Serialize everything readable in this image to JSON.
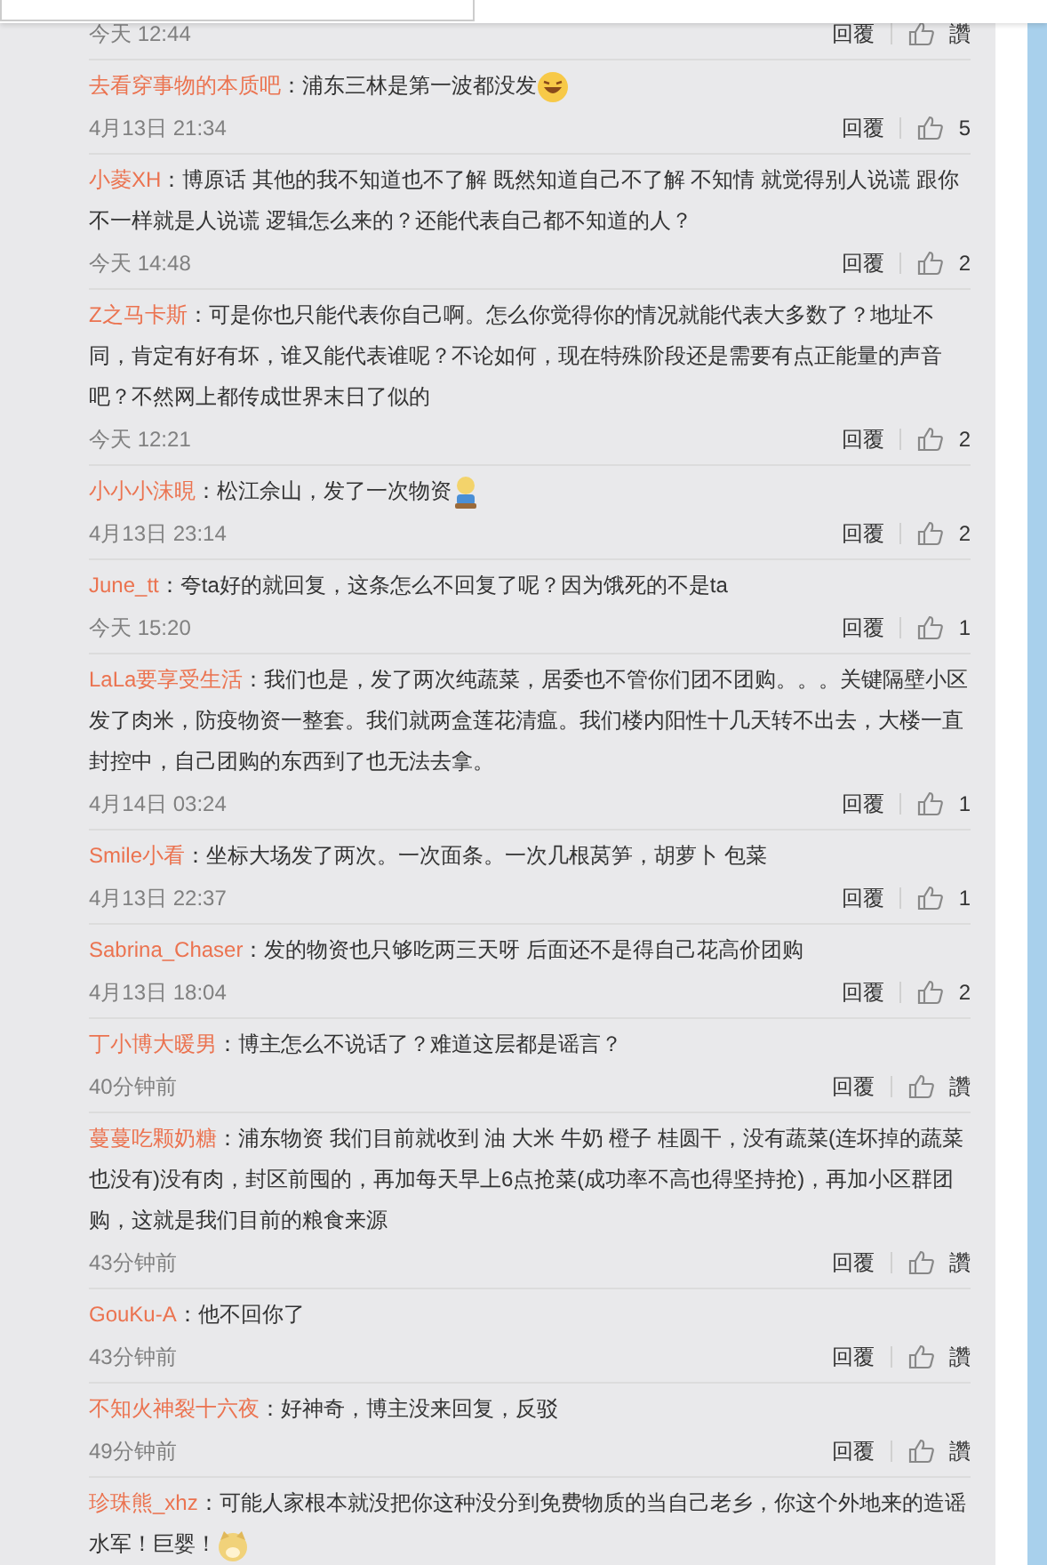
{
  "comments": [
    {
      "time": "今天 12:44",
      "reply": "回覆",
      "like": "讚"
    },
    {
      "user": "去看穿事物的本质吧",
      "text": "：浦东三林是第一波都没发",
      "emoji": {
        "kind": "laughing"
      },
      "time": "4月13日 21:34",
      "reply": "回覆",
      "like": "5"
    },
    {
      "user": "小菱XH",
      "text": "：博原话 其他的我不知道也不了解 既然知道自己不了解 不知情 就觉得别人说谎 跟你不一样就是人说谎 逻辑怎么来的？还能代表自己都不知道的人？",
      "time": "今天 14:48",
      "reply": "回覆",
      "like": "2"
    },
    {
      "user": "Z之马卡斯",
      "text": "：可是你也只能代表你自己啊。怎么你觉得你的情况就能代表大多数了？地址不同，肯定有好有坏，谁又能代表谁呢？不论如何，现在特殊阶段还是需要有点正能量的声音吧？不然网上都传成世界末日了似的",
      "time": "今天 12:21",
      "reply": "回覆",
      "like": "2"
    },
    {
      "user": "小小小沫晛",
      "text": "：松江佘山，发了一次物资",
      "emoji": {
        "kind": "figure"
      },
      "time": "4月13日 23:14",
      "reply": "回覆",
      "like": "2"
    },
    {
      "user": "June_tt",
      "text": "：夸ta好的就回复，这条怎么不回复了呢？因为饿死的不是ta",
      "time": "今天 15:20",
      "reply": "回覆",
      "like": "1"
    },
    {
      "user": "LaLa要享受生活",
      "text": "：我们也是，发了两次纯蔬菜，居委也不管你们团不团购。。。关键隔壁小区发了肉米，防疫物资一整套。我们就两盒莲花清瘟。我们楼内阳性十几天转不出去，大楼一直封控中，自己团购的东西到了也无法去拿。",
      "time": "4月14日 03:24",
      "reply": "回覆",
      "like": "1"
    },
    {
      "user": "Smile小看",
      "text": "：坐标大场发了两次。一次面条。一次几根莴笋，胡萝卜 包菜",
      "time": "4月13日 22:37",
      "reply": "回覆",
      "like": "1"
    },
    {
      "user": "Sabrina_Chaser",
      "text": "：发的物资也只够吃两三天呀 后面还不是得自己花高价团购",
      "time": "4月13日 18:04",
      "reply": "回覆",
      "like": "2"
    },
    {
      "user": "丁小博大暖男",
      "text": "：博主怎么不说话了？难道这层都是谣言？",
      "time": "40分钟前",
      "reply": "回覆",
      "like": "讚"
    },
    {
      "user": "蔓蔓吃颗奶糖",
      "text": "：浦东物资 我们目前就收到 油 大米 牛奶 橙子 桂圆干，没有蔬菜(连坏掉的蔬菜也没有)没有肉，封区前囤的，再加每天早上6点抢菜(成功率不高也得坚持抢)，再加小区群团购，这就是我们目前的粮食来源",
      "time": "43分钟前",
      "reply": "回覆",
      "like": "讚"
    },
    {
      "user": "GouKu-A",
      "text": "：他不回你了",
      "time": "43分钟前",
      "reply": "回覆",
      "like": "讚"
    },
    {
      "user": "不知火神裂十六夜",
      "text": "：好神奇，博主没来回复，反驳",
      "time": "49分钟前",
      "reply": "回覆",
      "like": "讚"
    },
    {
      "user": "珍珠熊_xhz",
      "text": "：可能人家根本就没把你这种没分到免费物质的当自己老乡，你这个外地来的造谣水军！巨婴！",
      "emoji": {
        "kind": "dog"
      }
    }
  ]
}
